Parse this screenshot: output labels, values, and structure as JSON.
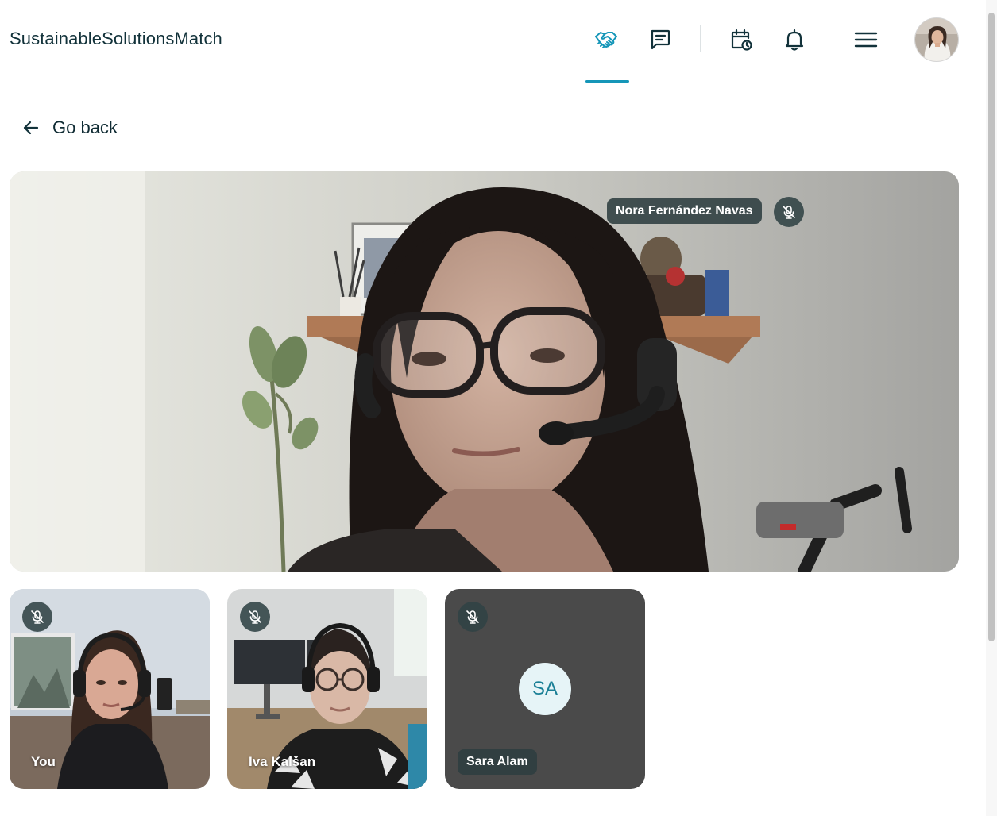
{
  "app": {
    "brand": "SustainableSolutionsMatch"
  },
  "header": {
    "nav": [
      {
        "name": "matches",
        "icon": "handshake-icon",
        "active": true
      },
      {
        "name": "messages",
        "icon": "message-icon",
        "active": false
      },
      {
        "name": "calendar",
        "icon": "calendar-clock-icon",
        "active": false
      },
      {
        "name": "notifications",
        "icon": "bell-icon",
        "active": false
      },
      {
        "name": "menu",
        "icon": "hamburger-menu-icon",
        "active": false
      }
    ],
    "active_color": "#1596b8"
  },
  "go_back": {
    "label": "Go back"
  },
  "call": {
    "main_speaker": {
      "name": "Nora Fernández Navas",
      "muted": true
    },
    "participants": [
      {
        "label": "You",
        "muted": true,
        "video": true
      },
      {
        "label": "Iva Kalšan",
        "muted": true,
        "video": true
      },
      {
        "label": "Sara Alam",
        "initials": "SA",
        "muted": true,
        "video": false
      }
    ]
  },
  "colors": {
    "tile_off": "#4a4a4a",
    "pill_bg": "#2d3e40",
    "accent": "#1596b8"
  }
}
